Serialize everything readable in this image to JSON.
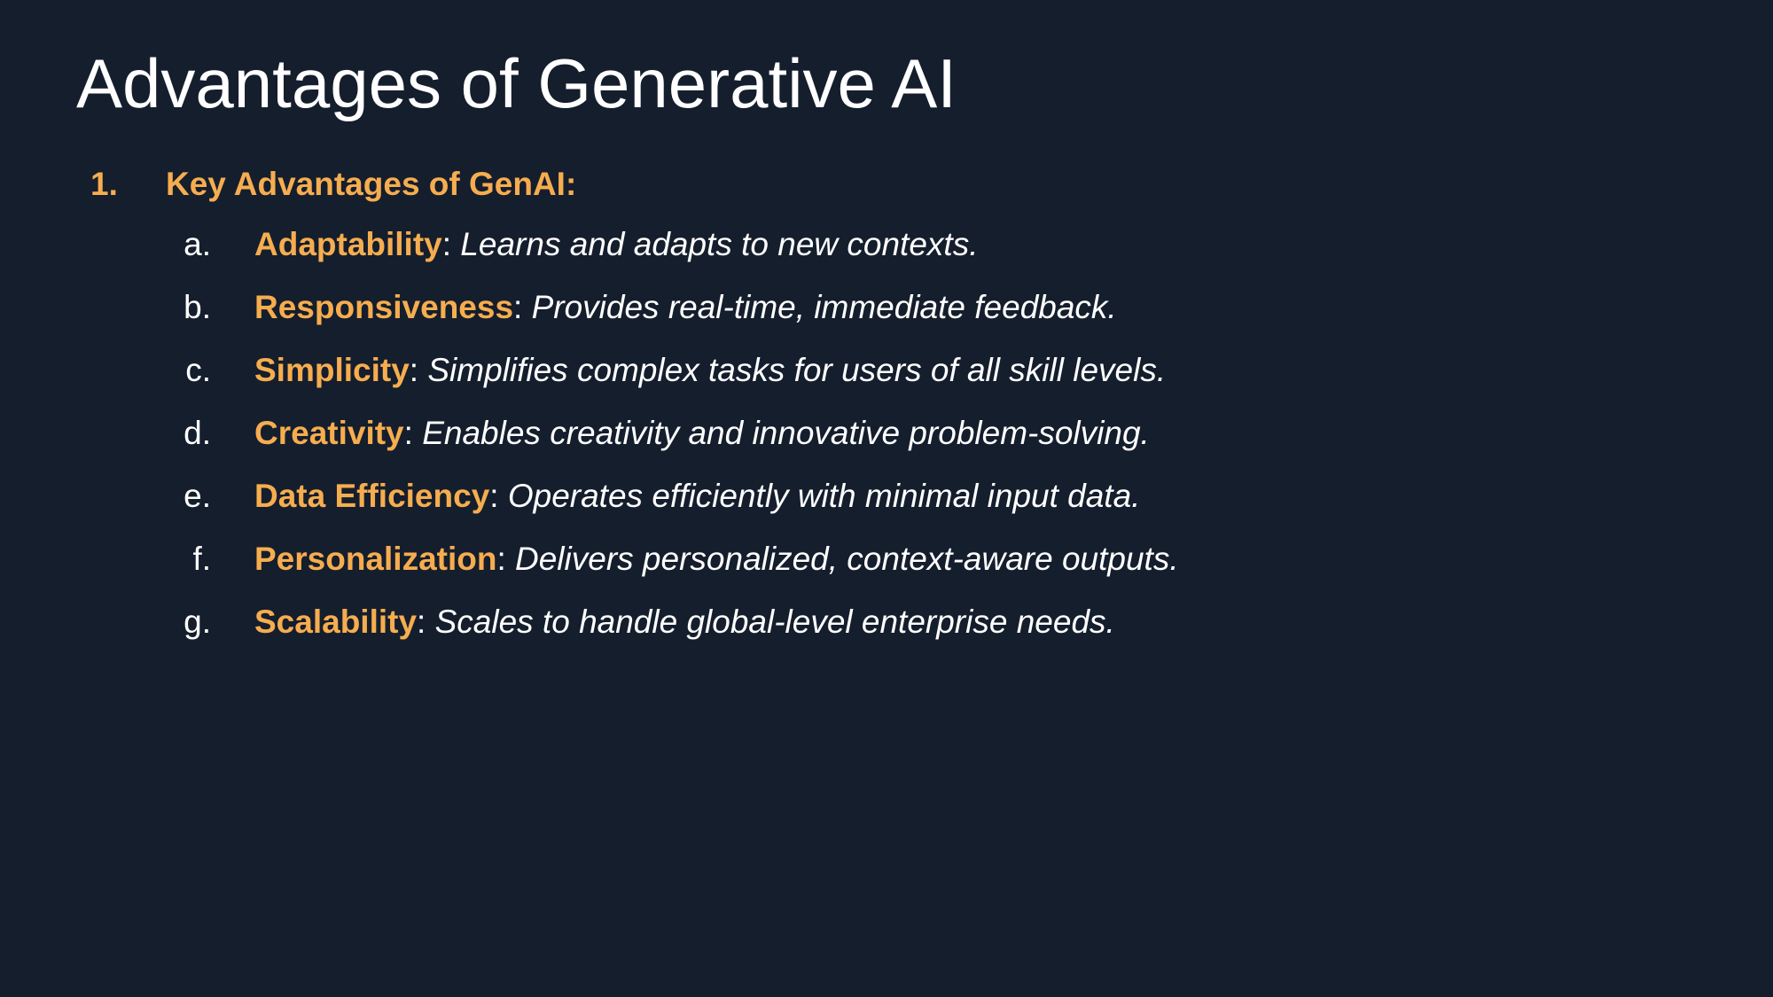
{
  "title": "Advantages of Generative AI",
  "section": {
    "number": "1.",
    "heading": "Key Advantages of GenAI:"
  },
  "items": [
    {
      "marker": "a.",
      "term": "Adaptability",
      "description": " Learns and adapts to new contexts."
    },
    {
      "marker": "b.",
      "term": "Responsiveness",
      "description": " Provides real-time, immediate feedback."
    },
    {
      "marker": "c.",
      "term": "Simplicity",
      "description": " Simplifies complex tasks for users of all skill levels."
    },
    {
      "marker": "d.",
      "term": "Creativity",
      "description": " Enables creativity and innovative problem-solving."
    },
    {
      "marker": "e.",
      "term": "Data Efficiency",
      "description": " Operates efficiently with minimal input data."
    },
    {
      "marker": "f.",
      "term": "Personalization",
      "description": " Delivers personalized, context-aware outputs."
    },
    {
      "marker": "g.",
      "term": "Scalability",
      "description": " Scales to handle global-level enterprise needs."
    }
  ],
  "colors": {
    "background": "#151e2d",
    "accent": "#f6ad4f",
    "text": "#ffffff"
  }
}
